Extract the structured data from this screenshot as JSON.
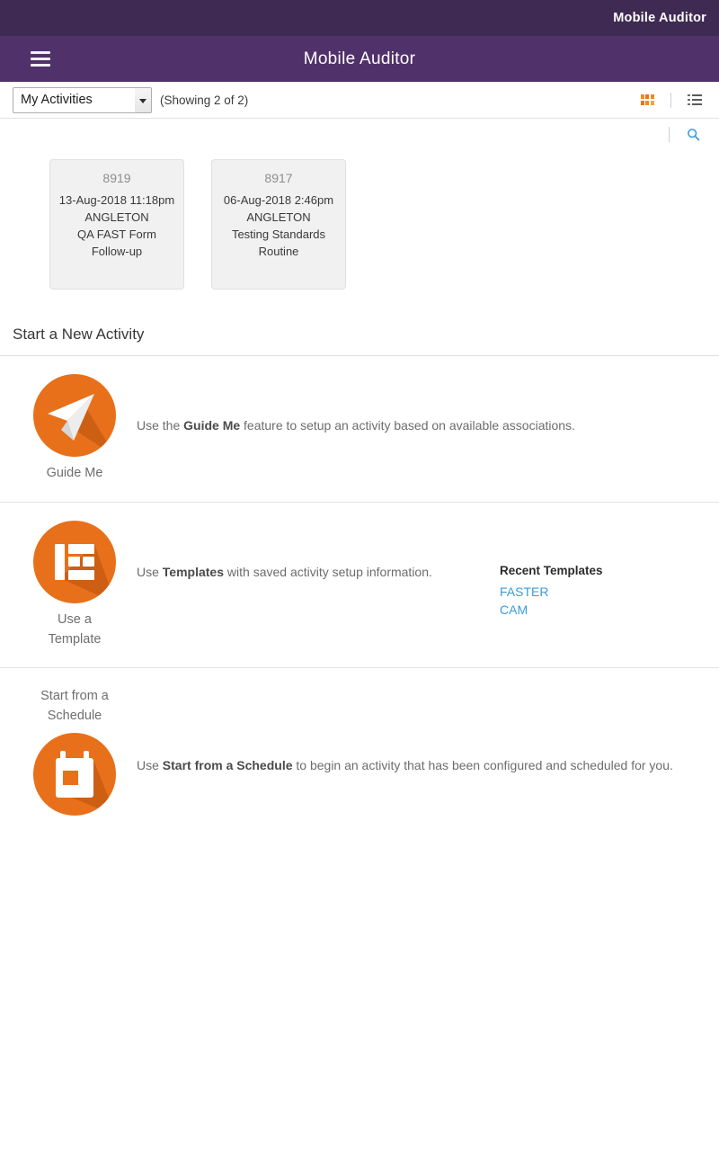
{
  "colors": {
    "topbar_bg": "#3e2a52",
    "appbar_bg": "#513169",
    "accent_orange": "#e8701a",
    "link_blue": "#3c9bdc",
    "card_bg": "#f1f1f1"
  },
  "topbar": {
    "title": "Mobile Auditor"
  },
  "appbar": {
    "title": "Mobile Auditor",
    "menu_icon": "hamburger-menu-icon"
  },
  "toolbar": {
    "filter_selected": "My Activities",
    "filter_options": [
      "My Activities"
    ],
    "showing_text": "(Showing 2 of 2)",
    "grid_view_icon": "grid-view-icon",
    "list_view_icon": "list-view-icon",
    "search_icon": "search-icon"
  },
  "activities": [
    {
      "id": "8919",
      "datetime": "13-Aug-2018 11:18pm",
      "location": "ANGLETON",
      "form": "QA FAST Form",
      "type": "Follow-up"
    },
    {
      "id": "8917",
      "datetime": "06-Aug-2018 2:46pm",
      "location": "ANGLETON",
      "form": "Testing Standards",
      "type": "Routine"
    }
  ],
  "new_activity": {
    "heading": "Start a New Activity",
    "rows": [
      {
        "label": "Guide Me",
        "icon": "paper-plane-icon",
        "desc_pre": "Use the ",
        "desc_bold": "Guide Me",
        "desc_post": " feature to setup an activity based on available associations."
      },
      {
        "label": "Use a\nTemplate",
        "label_line1": "Use a",
        "label_line2": "Template",
        "icon": "template-layout-icon",
        "desc_pre": "Use ",
        "desc_bold": "Templates",
        "desc_post": " with saved activity setup information.",
        "recent_title": "Recent Templates",
        "recent_links": [
          "FASTER",
          "CAM"
        ]
      },
      {
        "label_line1": "Start from a",
        "label_line2": "Schedule",
        "icon": "calendar-icon",
        "desc_pre": "Use ",
        "desc_bold": "Start from a Schedule",
        "desc_post": " to begin an activity that has been configured and scheduled for you."
      }
    ]
  }
}
